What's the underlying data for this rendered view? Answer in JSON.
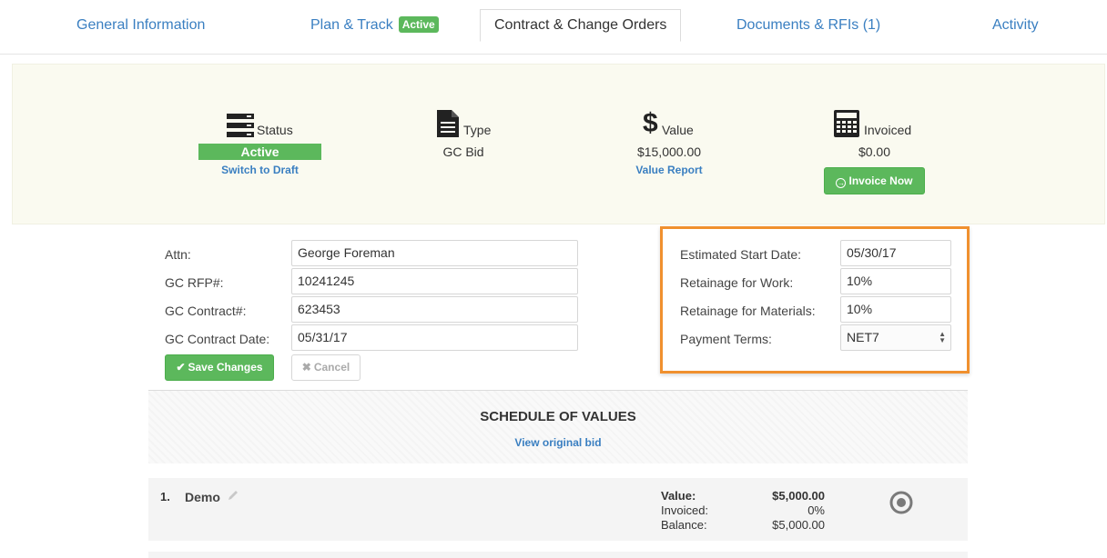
{
  "tabs": {
    "general": "General Information",
    "plan_track": "Plan & Track",
    "plan_track_badge": "Active",
    "contract": "Contract & Change Orders",
    "documents": "Documents & RFIs (1)",
    "activity": "Activity"
  },
  "summary": {
    "status": {
      "icon": "server-icon",
      "label": "Status",
      "value": "Active",
      "link": "Switch to Draft"
    },
    "type": {
      "icon": "document-icon",
      "label": "Type",
      "value": "GC Bid"
    },
    "value": {
      "icon": "dollar-icon",
      "label": "Value",
      "value": "$15,000.00",
      "link": "Value Report"
    },
    "invoiced": {
      "icon": "calculator-icon",
      "label": "Invoiced",
      "value": "$0.00",
      "button": "Invoice Now"
    }
  },
  "form": {
    "attn": {
      "label": "Attn:",
      "value": "George Foreman"
    },
    "gc_rfp": {
      "label": "GC RFP#:",
      "value": "10241245"
    },
    "gc_contract": {
      "label": "GC Contract#:",
      "value": "623453"
    },
    "gc_contract_date": {
      "label": "GC Contract Date:",
      "value": "05/31/17"
    },
    "save_label": "Save Changes",
    "cancel_label": "Cancel"
  },
  "terms": {
    "start_date": {
      "label": "Estimated Start Date:",
      "value": "05/30/17"
    },
    "retainage_work": {
      "label": "Retainage for Work:",
      "value": "10%"
    },
    "retainage_materials": {
      "label": "Retainage for Materials:",
      "value": "10%"
    },
    "payment_terms": {
      "label": "Payment Terms:",
      "value": "NET7"
    }
  },
  "schedule": {
    "title": "SCHEDULE OF VALUES",
    "link": "View original bid",
    "items": [
      {
        "number": "1.",
        "name": "Demo",
        "value_label": "Value:",
        "value": "$5,000.00",
        "invoiced_label": "Invoiced:",
        "invoiced": "0%",
        "balance_label": "Balance:",
        "balance": "$5,000.00"
      }
    ]
  },
  "colors": {
    "link": "#3a7fc1",
    "success": "#5cb85c",
    "highlight": "#f0902e",
    "panel": "#fafaf0"
  }
}
